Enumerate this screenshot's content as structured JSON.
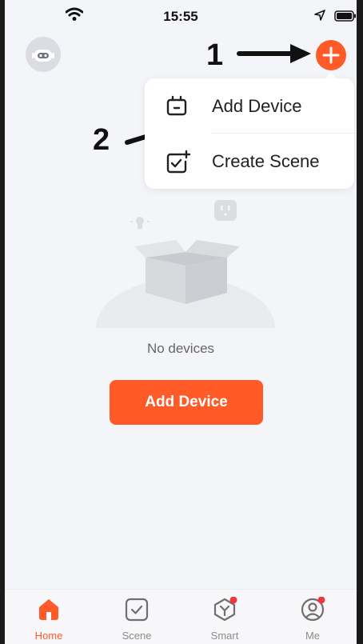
{
  "status_bar": {
    "time": "15:55"
  },
  "annotations": {
    "step1": "1",
    "step2": "2"
  },
  "menu": {
    "items": [
      {
        "label": "Add Device",
        "icon": "add-device-icon"
      },
      {
        "label": "Create Scene",
        "icon": "create-scene-icon"
      }
    ]
  },
  "empty_state": {
    "text": "No devices",
    "button_label": "Add Device"
  },
  "tabs": [
    {
      "label": "Home",
      "icon": "home-icon",
      "active": true
    },
    {
      "label": "Scene",
      "icon": "scene-icon"
    },
    {
      "label": "Smart",
      "icon": "smart-icon",
      "badge": true
    },
    {
      "label": "Me",
      "icon": "me-icon",
      "badge": true
    }
  ],
  "colors": {
    "accent": "#ff5a28",
    "background": "#f4f5f8",
    "badge": "#f0353f"
  }
}
